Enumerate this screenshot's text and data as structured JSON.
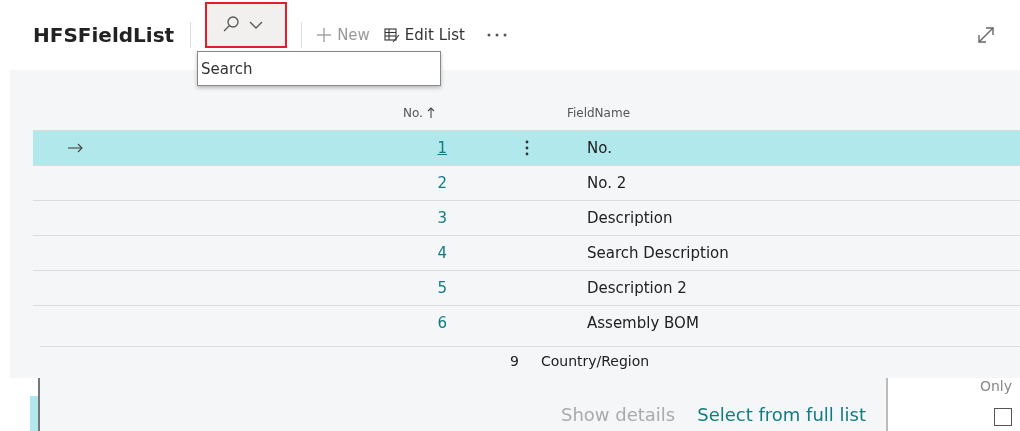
{
  "page": {
    "title": "HFSFieldList"
  },
  "toolbar": {
    "search_button": {
      "highlighted": true
    },
    "actions": [
      {
        "kind": "new",
        "label": "New",
        "disabled": true
      },
      {
        "kind": "edit",
        "label": "Edit List",
        "disabled": false
      }
    ]
  },
  "search_box": {
    "placeholder": "Search"
  },
  "table": {
    "columns": [
      {
        "label": "No."
      },
      {
        "label": "FieldName"
      }
    ],
    "rows": [
      {
        "no": "1",
        "field_name": "No.",
        "selected": true
      },
      {
        "no": "2",
        "field_name": "No. 2",
        "selected": false
      },
      {
        "no": "3",
        "field_name": "Description",
        "selected": false
      },
      {
        "no": "4",
        "field_name": "Search Description",
        "selected": false
      },
      {
        "no": "5",
        "field_name": "Description 2",
        "selected": false
      },
      {
        "no": "6",
        "field_name": "Assembly BOM",
        "selected": false
      }
    ]
  },
  "behind": {
    "row": {
      "no": "9",
      "field_name": "Country/Region"
    },
    "links": [
      {
        "label": "Show details",
        "disabled": true
      },
      {
        "label": "Select from full list",
        "disabled": false
      }
    ],
    "column_heading": "Only",
    "checkbox": {
      "checked": false
    }
  }
}
